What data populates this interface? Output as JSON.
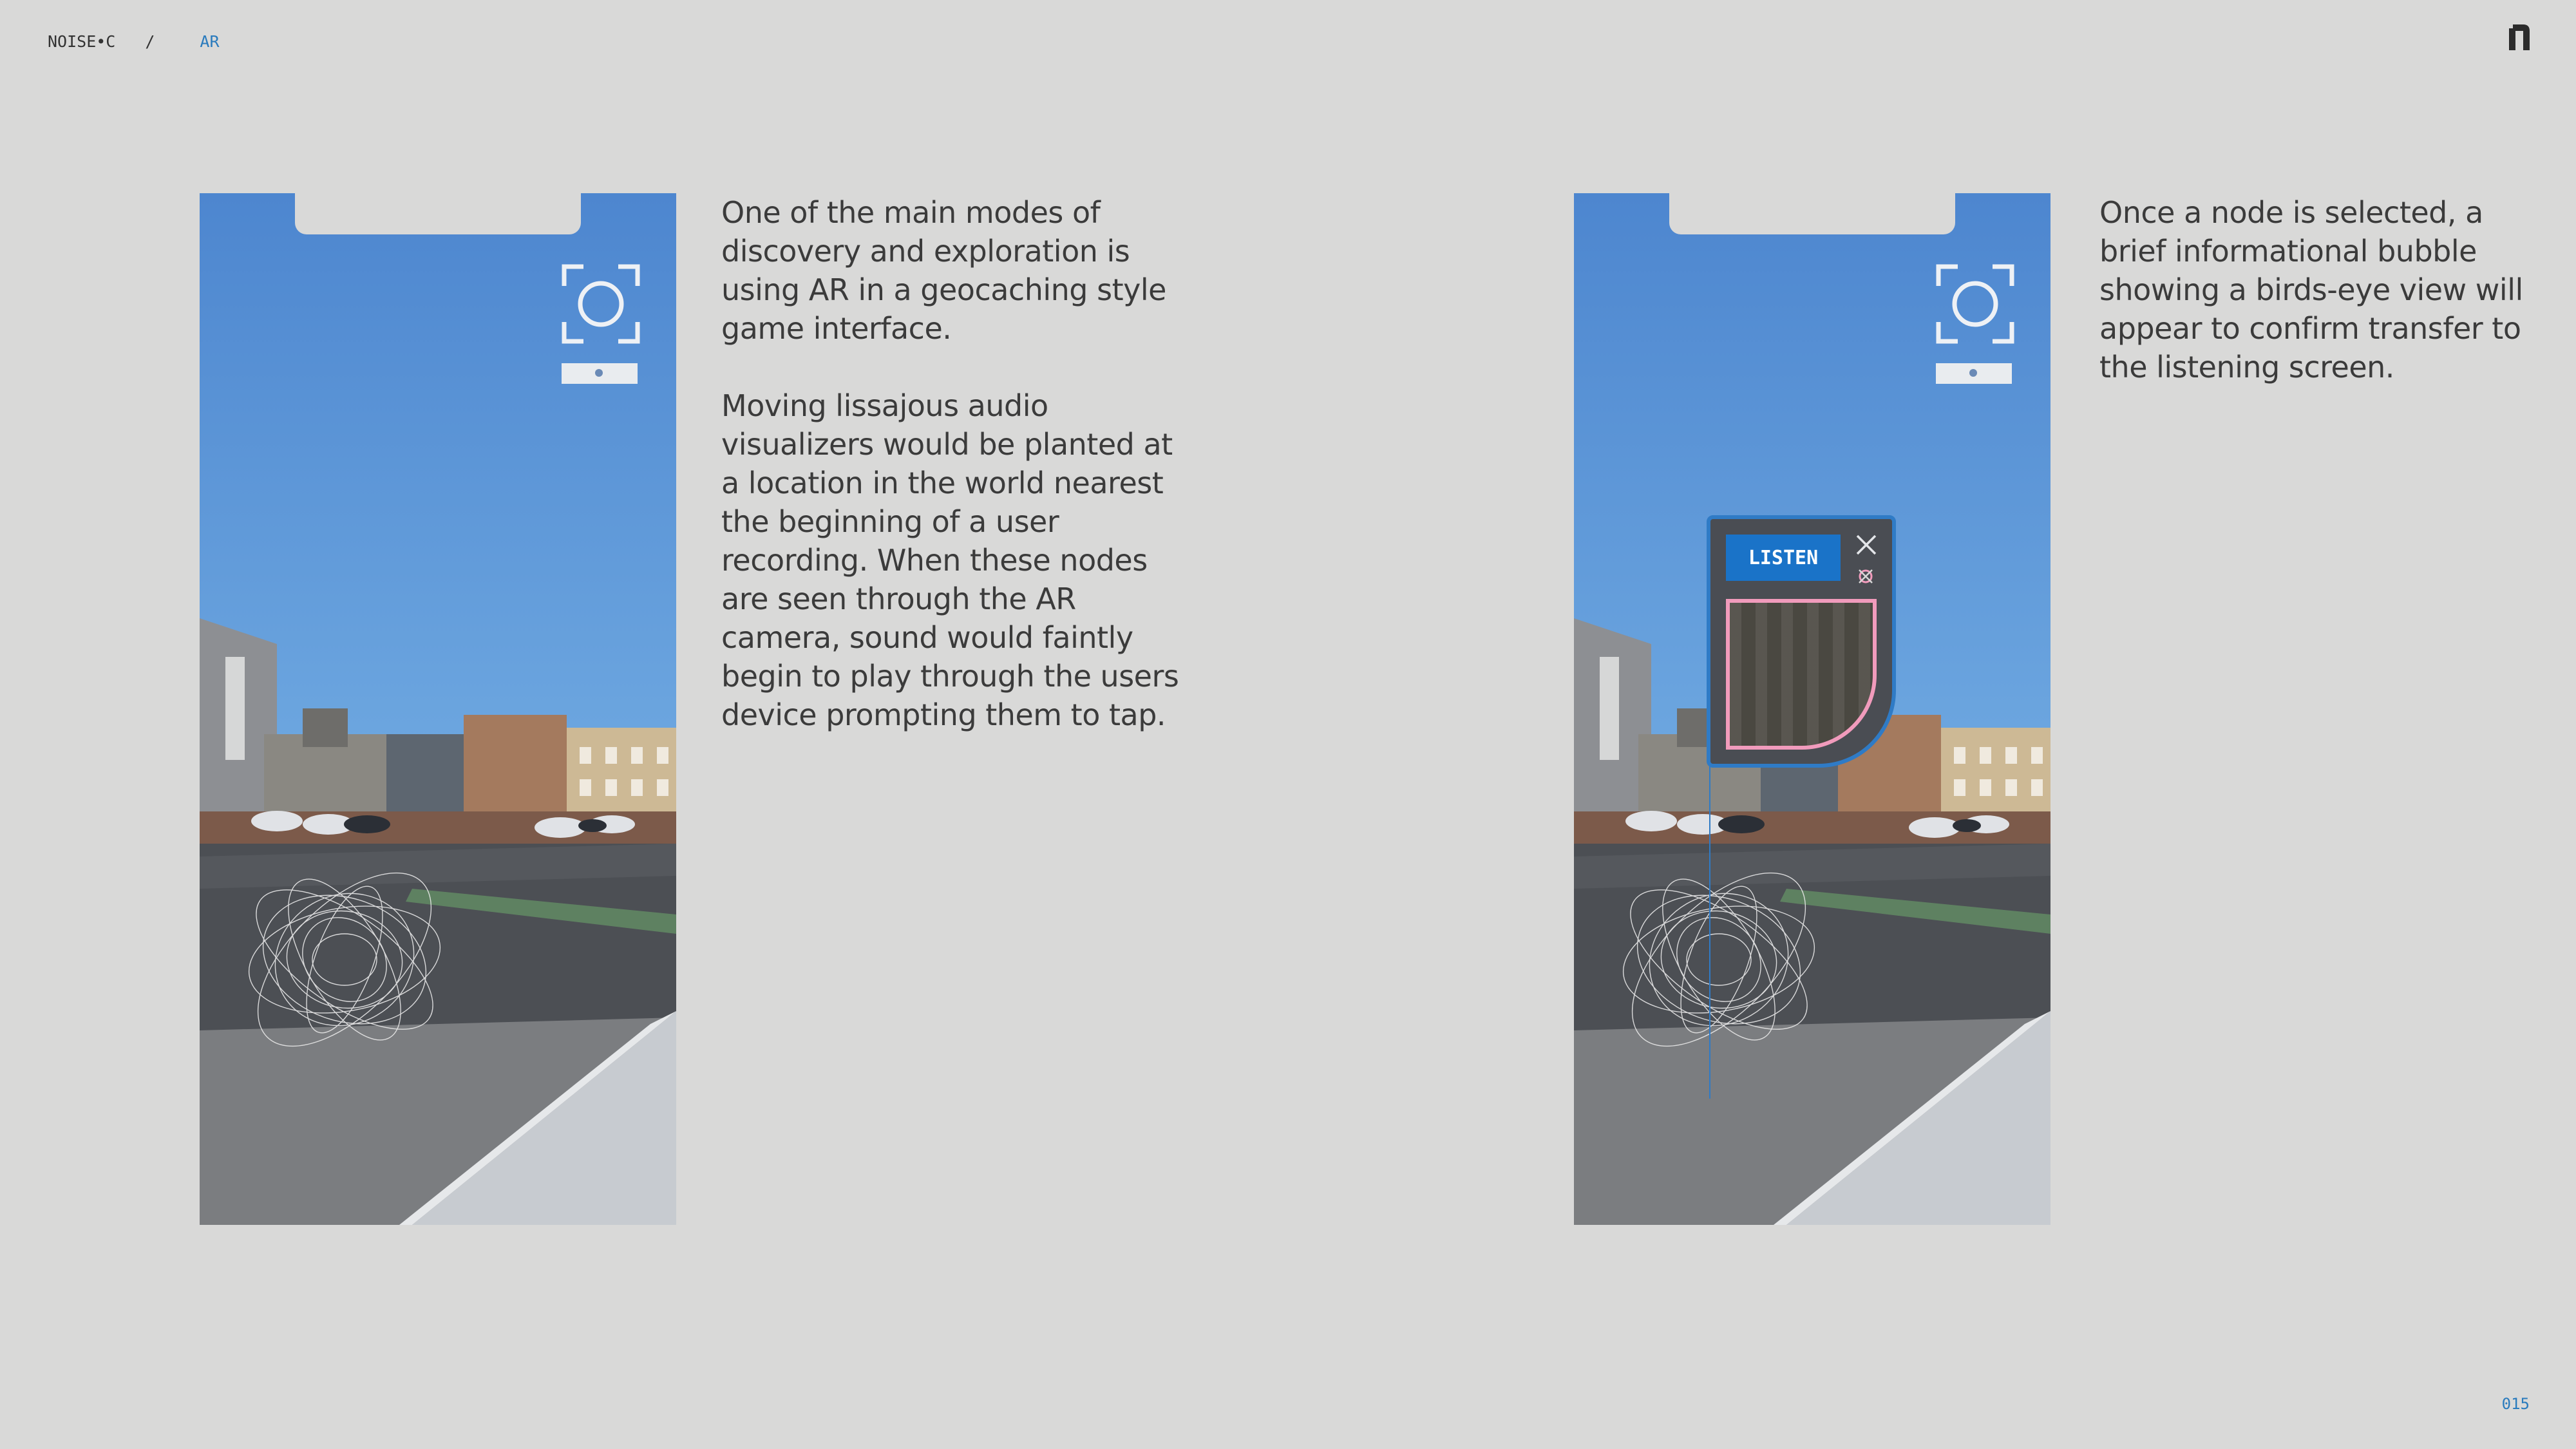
{
  "breadcrumb": {
    "root": "NOISE•C",
    "separator": "/",
    "current": "AR"
  },
  "page_number": "015",
  "logo_icon": "n-monogram-icon",
  "colors": {
    "background": "#d9d9d8",
    "accent": "#2a7bbd",
    "listen_button": "#1a73c8",
    "preview_border": "#f19bbc"
  },
  "screen_left": {
    "camera_icon": "ar-camera-focus-icon",
    "visualizer": "lissajous-node-icon"
  },
  "screen_right": {
    "camera_icon": "ar-camera-focus-icon",
    "visualizer": "lissajous-node-icon",
    "popup": {
      "listen_label": "LISTEN",
      "close_icon": "close-icon",
      "favorite_icon": "favorite-icon"
    }
  },
  "text_left": {
    "paragraph_1": "One of the main modes of discovery and exploration is using AR in a geocaching style game interface.",
    "paragraph_2": "Moving lissajous audio visualizers would be planted at a location in the world nearest the beginning of a user recording. When these nodes are seen through the AR camera, sound would faintly begin to play through the users device prompting them to tap."
  },
  "text_right": {
    "paragraph_1": "Once a node is selected, a brief informational bubble showing a birds-eye view will appear to confirm transfer to the listening screen."
  }
}
